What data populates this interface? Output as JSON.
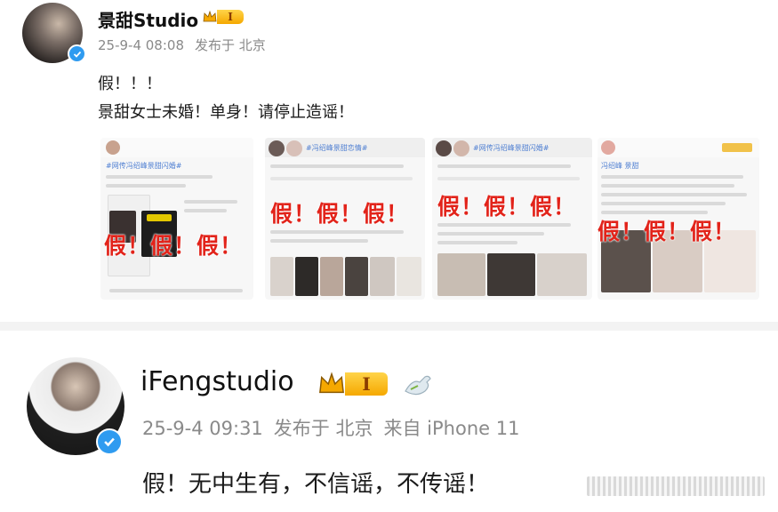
{
  "post1": {
    "author": "景甜Studio",
    "level": "I",
    "time": "25-9-4 08:08",
    "location": "发布于 北京",
    "lines": [
      "假！！！",
      "景甜女士未婚！单身！请停止造谣！"
    ],
    "thumbnails": [
      {
        "tag": "#网传冯绍峰景甜闪婚#",
        "stamp": "假！假！假！"
      },
      {
        "tag": "#冯绍峰景甜恋情#",
        "stamp": "假！假！假！"
      },
      {
        "tag": "#网传冯绍峰景甜闪婚#",
        "stamp": "假！假！假！"
      },
      {
        "tag": "冯绍峰 景甜",
        "stamp": "假！假！假！"
      }
    ]
  },
  "post2": {
    "author": "iFengstudio",
    "level": "I",
    "time": "25-9-4 09:31",
    "location": "发布于 北京",
    "source": "来自 iPhone 11",
    "line": "假！无中生有，不信谣，不传谣！"
  },
  "colors": {
    "stamp": "#e2231a",
    "verified": "#2f9bf0",
    "badge": "#f5a800",
    "meta": "#8a8a8a"
  },
  "icons": {
    "verified": "verified-check-icon",
    "crown": "crown-icon",
    "dove": "dove-icon"
  }
}
